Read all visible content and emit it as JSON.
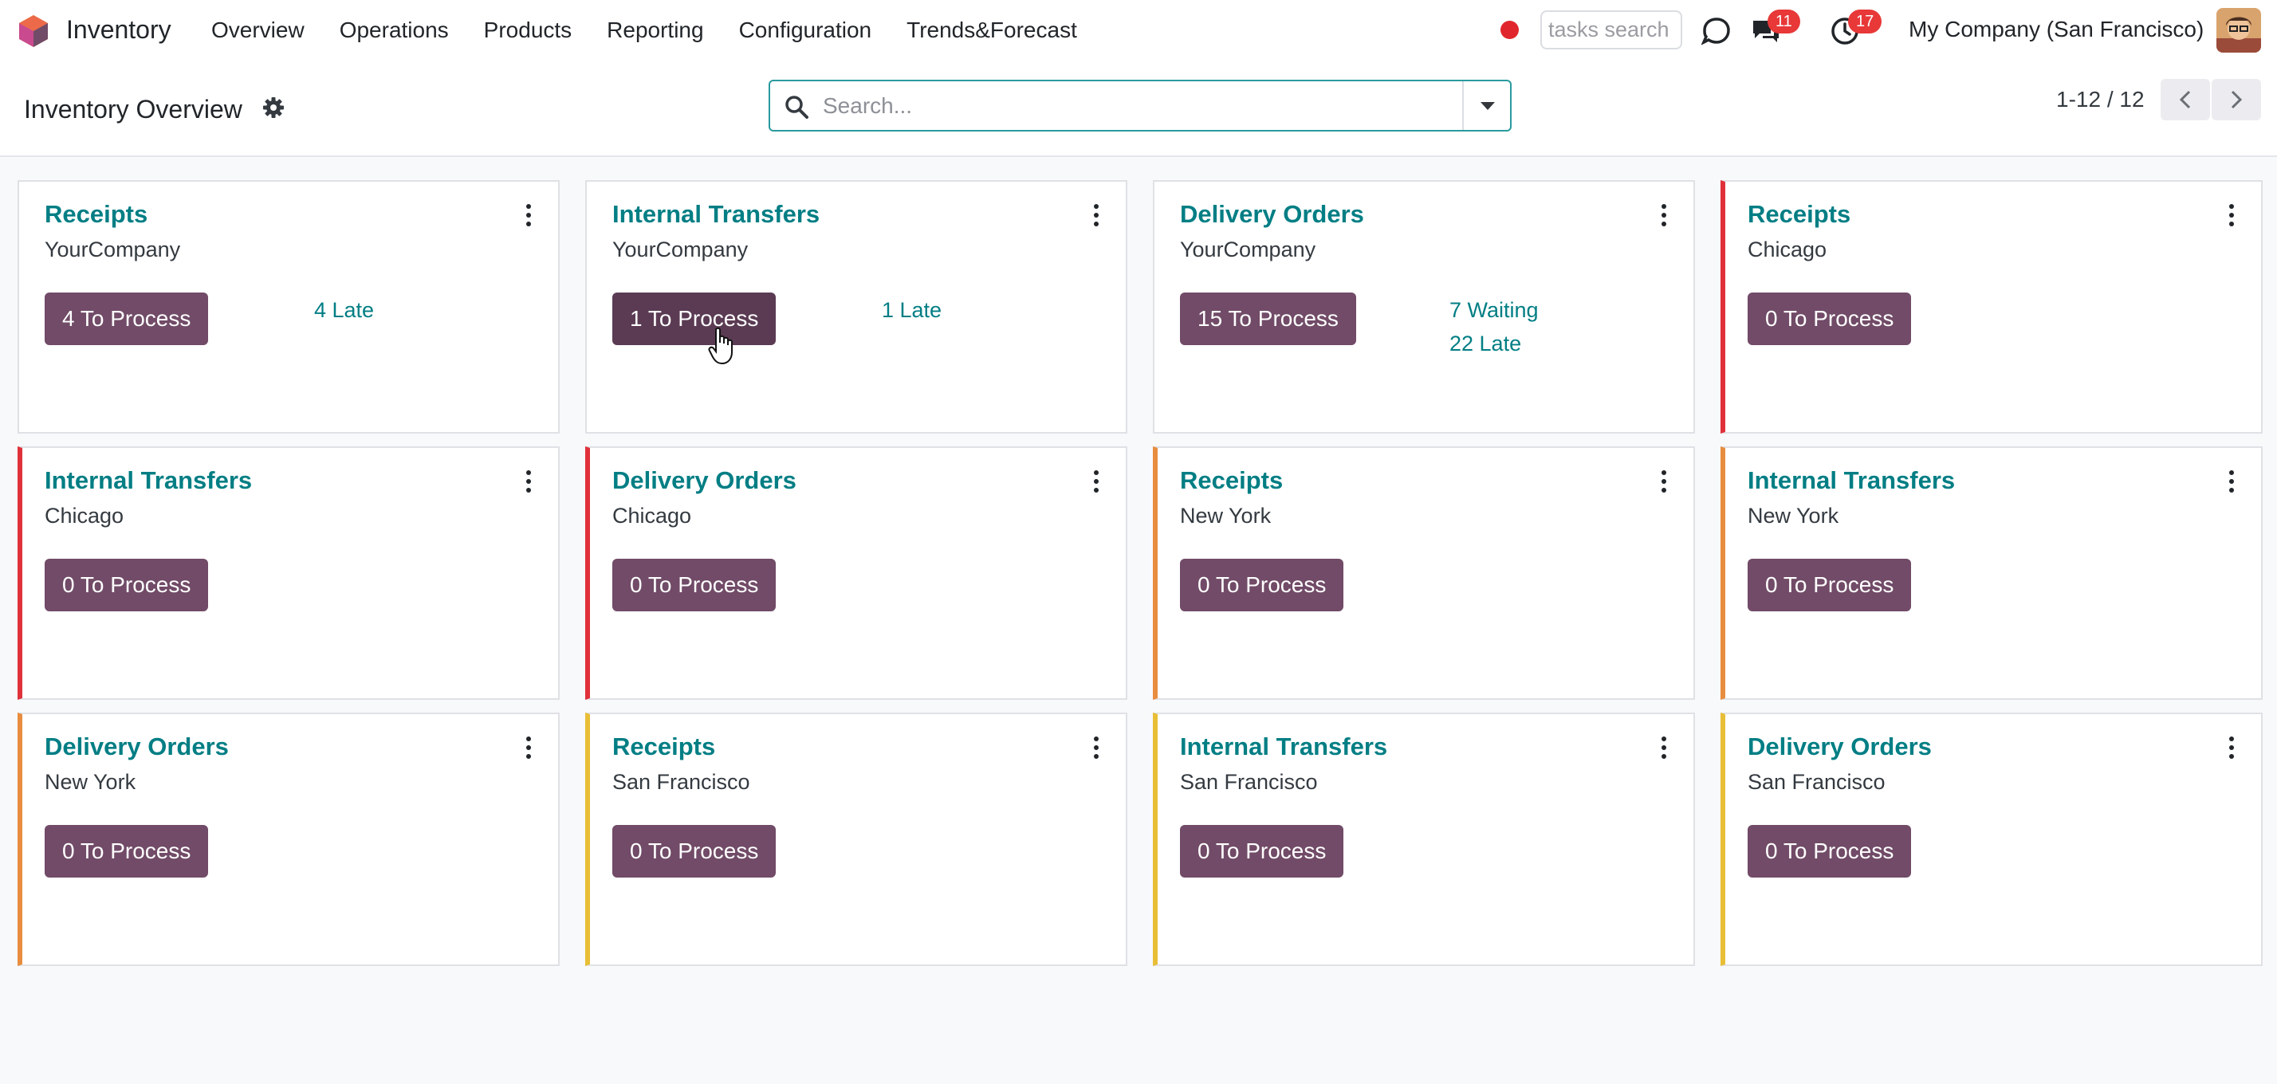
{
  "navbar": {
    "app_name": "Inventory",
    "menu": [
      "Overview",
      "Operations",
      "Products",
      "Reporting",
      "Configuration",
      "Trends&Forecast"
    ],
    "tasks_search_placeholder": "tasks search",
    "messages_count": "11",
    "activities_count": "17",
    "company": "My Company (San Francisco)"
  },
  "control_panel": {
    "title": "Inventory Overview",
    "search_placeholder": "Search...",
    "pager": "1-12 / 12"
  },
  "cards": [
    {
      "title": "Receipts",
      "warehouse": "YourCompany",
      "button": "4 To Process",
      "stats": [
        "4 Late"
      ],
      "accent": ""
    },
    {
      "title": "Internal Transfers",
      "warehouse": "YourCompany",
      "button": "1 To Process",
      "stats": [
        "1 Late"
      ],
      "accent": ""
    },
    {
      "title": "Delivery Orders",
      "warehouse": "YourCompany",
      "button": "15 To Process",
      "stats": [
        "7 Waiting",
        "22 Late"
      ],
      "accent": ""
    },
    {
      "title": "Receipts",
      "warehouse": "Chicago",
      "button": "0 To Process",
      "stats": [],
      "accent": "red"
    },
    {
      "title": "Internal Transfers",
      "warehouse": "Chicago",
      "button": "0 To Process",
      "stats": [],
      "accent": "red"
    },
    {
      "title": "Delivery Orders",
      "warehouse": "Chicago",
      "button": "0 To Process",
      "stats": [],
      "accent": "red"
    },
    {
      "title": "Receipts",
      "warehouse": "New York",
      "button": "0 To Process",
      "stats": [],
      "accent": "orange"
    },
    {
      "title": "Internal Transfers",
      "warehouse": "New York",
      "button": "0 To Process",
      "stats": [],
      "accent": "orange"
    },
    {
      "title": "Delivery Orders",
      "warehouse": "New York",
      "button": "0 To Process",
      "stats": [],
      "accent": "orange"
    },
    {
      "title": "Receipts",
      "warehouse": "San Francisco",
      "button": "0 To Process",
      "stats": [],
      "accent": "yellow"
    },
    {
      "title": "Internal Transfers",
      "warehouse": "San Francisco",
      "button": "0 To Process",
      "stats": [],
      "accent": "yellow"
    },
    {
      "title": "Delivery Orders",
      "warehouse": "San Francisco",
      "button": "0 To Process",
      "stats": [],
      "accent": "yellow"
    }
  ],
  "colors": {
    "primary": "#714b67",
    "link": "#017e84",
    "red": "#e0313b",
    "orange": "#e88d3f",
    "yellow": "#e8be36"
  }
}
